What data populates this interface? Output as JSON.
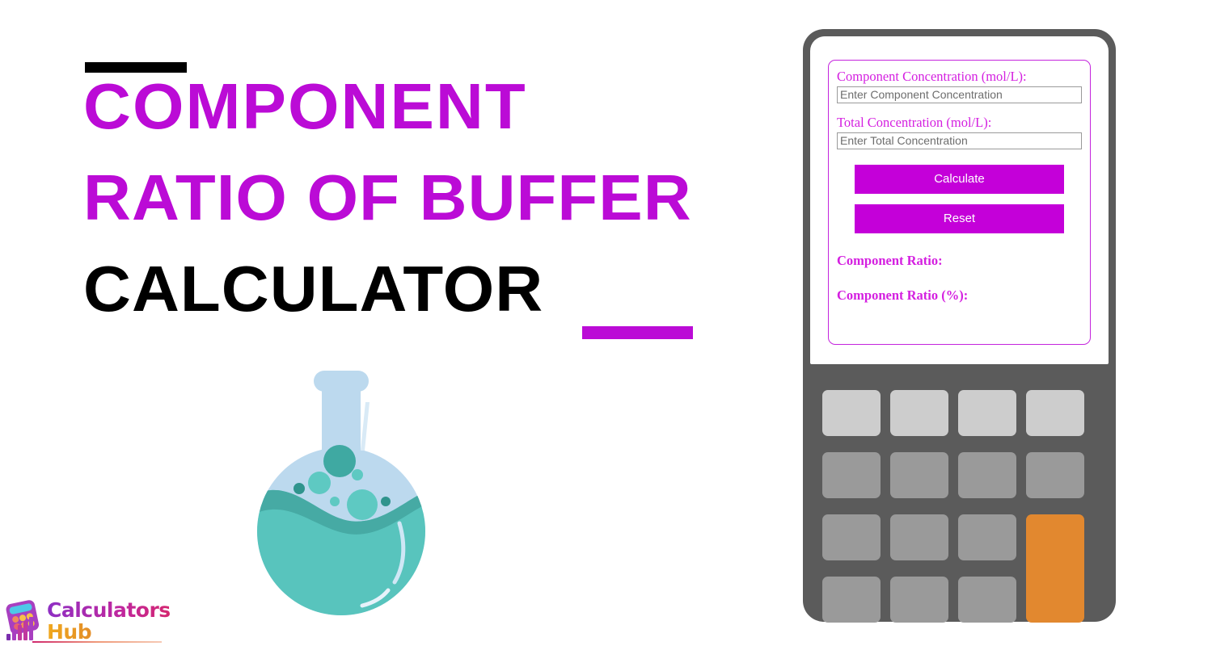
{
  "hero": {
    "title_lines": [
      "COMPONENT",
      "RATIO OF BUFFER",
      "CALCULATOR"
    ],
    "accent_color": "#bb0bd6",
    "rule_color_top": "#000000",
    "rule_color_bottom": "#bb0bd6"
  },
  "illustration": {
    "name": "round-bottom-flask",
    "glass_color": "#bcd9ee",
    "liquid_color": "#58c4bd",
    "liquid_shadow_color": "#46aaa4",
    "bubble_colors": [
      "#3fa9a2",
      "#5ec9c2",
      "#2f948d"
    ]
  },
  "logo": {
    "word_1": "Calculators",
    "word_2": "Hub",
    "icon": "calculator-bar-chart-icon",
    "word_1_colors": [
      "#8e2fc4",
      "#d4276f"
    ],
    "word_2_colors": [
      "#f0a81e",
      "#a83fc0"
    ]
  },
  "calculator": {
    "body_color": "#5b5b5b",
    "screen_color": "#ffffff",
    "panel_border_color": "#c424dd",
    "form": {
      "fields": [
        {
          "label": "Component Concentration (mol/L):",
          "placeholder": "Enter Component Concentration",
          "value": ""
        },
        {
          "label": "Total Concentration (mol/L):",
          "placeholder": "Enter Total Concentration",
          "value": ""
        }
      ],
      "buttons": {
        "calculate": "Calculate",
        "reset": "Reset",
        "color": "#c400d9",
        "text_color": "#ffffff"
      },
      "results": [
        {
          "label": "Component Ratio:",
          "value": ""
        },
        {
          "label": "Component Ratio (%):",
          "value": ""
        }
      ],
      "label_color": "#d41fe0"
    },
    "keypad": {
      "rows": 4,
      "columns": 4,
      "key_color": "#9a9a9a",
      "top_row_key_color": "#cdcdcd",
      "accent_key_color": "#e2882f",
      "accent_key_name": "equals-key"
    }
  }
}
